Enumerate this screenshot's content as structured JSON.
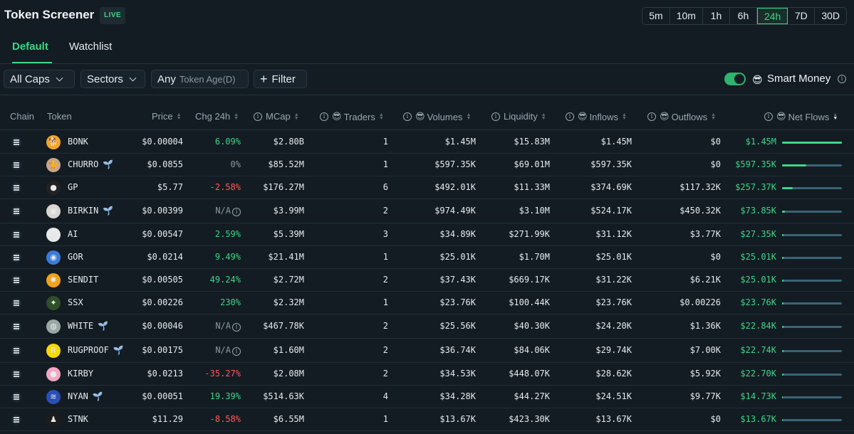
{
  "header": {
    "title": "Token Screener",
    "live_badge": "LIVE"
  },
  "timeframes": [
    "5m",
    "10m",
    "1h",
    "6h",
    "24h",
    "7D",
    "30D"
  ],
  "active_timeframe": "24h",
  "tabs": [
    {
      "label": "Default",
      "active": true
    },
    {
      "label": "Watchlist",
      "active": false
    }
  ],
  "filters": {
    "caps": "All Caps",
    "sectors": "Sectors",
    "token_age_value": "Any",
    "token_age_label": "Token Age(D)",
    "filter_btn": "Filter",
    "smart_money_label": "Smart Money",
    "smart_money_enabled": true
  },
  "columns": {
    "chain": "Chain",
    "token": "Token",
    "price": "Price",
    "chg": "Chg 24h",
    "mcap": "MCap",
    "traders": "Traders",
    "volumes": "Volumes",
    "liquidity": "Liquidity",
    "inflows": "Inflows",
    "outflows": "Outflows",
    "netflows": "Net Flows"
  },
  "colors": {
    "accent": "#3fd587",
    "negative": "#ff5a5a",
    "background": "#131c23",
    "bar_track": "#3a6474"
  },
  "rows": [
    {
      "symbol": "BONK",
      "dev": false,
      "price": "$0.00004",
      "chg": "6.09%",
      "chg_dir": "up",
      "mcap": "$2.80B",
      "traders": "1",
      "volumes": "$1.45M",
      "liquidity": "$15.83M",
      "inflows": "$1.45M",
      "outflows": "$0",
      "netflows": "$1.45M",
      "net_pct": 100,
      "icon": "bonk-dog-icon"
    },
    {
      "symbol": "CHURRO",
      "dev": true,
      "price": "$0.0855",
      "chg": "0%",
      "chg_dir": "flat",
      "mcap": "$85.52M",
      "traders": "1",
      "volumes": "$597.35K",
      "liquidity": "$69.01M",
      "inflows": "$597.35K",
      "outflows": "$0",
      "netflows": "$597.35K",
      "net_pct": 41,
      "icon": "churro-icon"
    },
    {
      "symbol": "GP",
      "dev": false,
      "price": "$5.77",
      "chg": "-2.58%",
      "chg_dir": "down",
      "mcap": "$176.27M",
      "traders": "6",
      "volumes": "$492.01K",
      "liquidity": "$11.33M",
      "inflows": "$374.69K",
      "outflows": "$117.32K",
      "netflows": "$257.37K",
      "net_pct": 18,
      "icon": "gp-icon"
    },
    {
      "symbol": "BIRKIN",
      "dev": true,
      "price": "$0.00399",
      "chg": "N/A",
      "chg_dir": "na",
      "mcap": "$3.99M",
      "traders": "2",
      "volumes": "$974.49K",
      "liquidity": "$3.10M",
      "inflows": "$524.17K",
      "outflows": "$450.32K",
      "netflows": "$73.85K",
      "net_pct": 5,
      "icon": "birkin-bag-icon"
    },
    {
      "symbol": "AI",
      "dev": false,
      "price": "$0.00547",
      "chg": "2.59%",
      "chg_dir": "up",
      "mcap": "$5.39M",
      "traders": "3",
      "volumes": "$34.89K",
      "liquidity": "$271.99K",
      "inflows": "$31.12K",
      "outflows": "$3.77K",
      "netflows": "$27.35K",
      "net_pct": 2,
      "icon": "ai-icon"
    },
    {
      "symbol": "GOR",
      "dev": false,
      "price": "$0.0214",
      "chg": "9.49%",
      "chg_dir": "up",
      "mcap": "$21.41M",
      "traders": "1",
      "volumes": "$25.01K",
      "liquidity": "$1.70M",
      "inflows": "$25.01K",
      "outflows": "$0",
      "netflows": "$25.01K",
      "net_pct": 2,
      "icon": "gor-icon"
    },
    {
      "symbol": "SENDIT",
      "dev": false,
      "price": "$0.00505",
      "chg": "49.24%",
      "chg_dir": "up",
      "mcap": "$2.72M",
      "traders": "2",
      "volumes": "$37.43K",
      "liquidity": "$669.17K",
      "inflows": "$31.22K",
      "outflows": "$6.21K",
      "netflows": "$25.01K",
      "net_pct": 2,
      "icon": "sendit-icon"
    },
    {
      "symbol": "SSX",
      "dev": false,
      "price": "$0.00226",
      "chg": "230%",
      "chg_dir": "up",
      "mcap": "$2.32M",
      "traders": "1",
      "volumes": "$23.76K",
      "liquidity": "$100.44K",
      "inflows": "$23.76K",
      "outflows": "$0.00226",
      "netflows": "$23.76K",
      "net_pct": 2,
      "icon": "ssx-icon"
    },
    {
      "symbol": "WHITE",
      "dev": true,
      "price": "$0.00046",
      "chg": "N/A",
      "chg_dir": "na",
      "mcap": "$467.78K",
      "traders": "2",
      "volumes": "$25.56K",
      "liquidity": "$40.30K",
      "inflows": "$24.20K",
      "outflows": "$1.36K",
      "netflows": "$22.84K",
      "net_pct": 2,
      "icon": "white-icon"
    },
    {
      "symbol": "RUGPROOF",
      "dev": true,
      "price": "$0.00175",
      "chg": "N/A",
      "chg_dir": "na",
      "mcap": "$1.60M",
      "traders": "2",
      "volumes": "$36.74K",
      "liquidity": "$84.06K",
      "inflows": "$29.74K",
      "outflows": "$7.00K",
      "netflows": "$22.74K",
      "net_pct": 2,
      "icon": "rugproof-icon"
    },
    {
      "symbol": "KIRBY",
      "dev": false,
      "price": "$0.0213",
      "chg": "-35.27%",
      "chg_dir": "down",
      "mcap": "$2.08M",
      "traders": "2",
      "volumes": "$34.53K",
      "liquidity": "$448.07K",
      "inflows": "$28.62K",
      "outflows": "$5.92K",
      "netflows": "$22.70K",
      "net_pct": 2,
      "icon": "kirby-icon"
    },
    {
      "symbol": "NYAN",
      "dev": true,
      "price": "$0.00051",
      "chg": "19.39%",
      "chg_dir": "up",
      "mcap": "$514.63K",
      "traders": "4",
      "volumes": "$34.28K",
      "liquidity": "$44.27K",
      "inflows": "$24.51K",
      "outflows": "$9.77K",
      "netflows": "$14.73K",
      "net_pct": 1,
      "icon": "nyan-icon"
    },
    {
      "symbol": "STNK",
      "dev": false,
      "price": "$11.29",
      "chg": "-8.58%",
      "chg_dir": "down",
      "mcap": "$6.55M",
      "traders": "1",
      "volumes": "$13.67K",
      "liquidity": "$423.30K",
      "inflows": "$13.67K",
      "outflows": "$0",
      "netflows": "$13.67K",
      "net_pct": 1,
      "icon": "stnk-icon"
    }
  ]
}
